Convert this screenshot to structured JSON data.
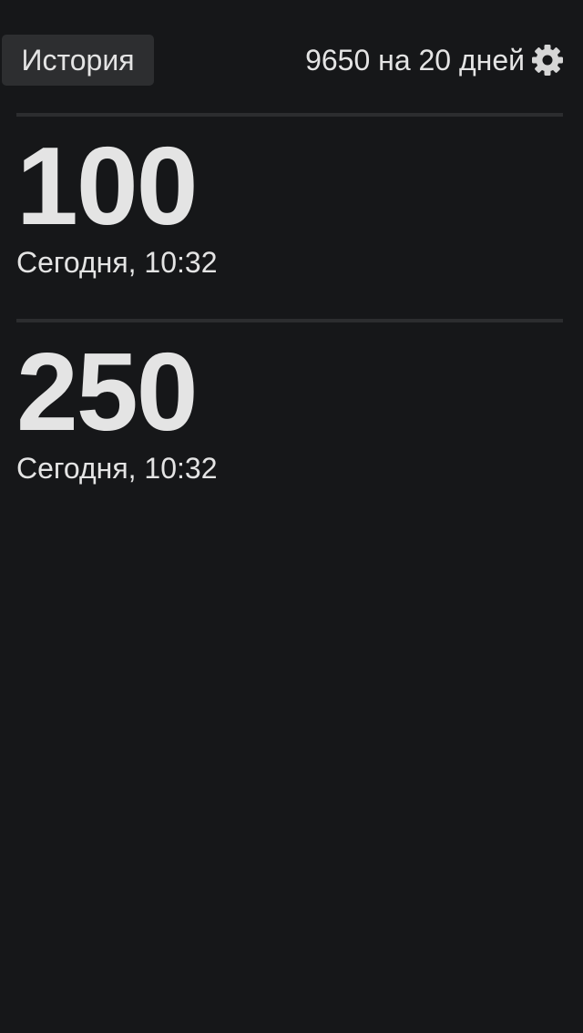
{
  "header": {
    "history_label": "История",
    "balance_text": "9650 на 20 дней",
    "settings_icon": "gear-icon"
  },
  "entries": [
    {
      "amount": "100",
      "date": "Сегодня, 10:32"
    },
    {
      "amount": "250",
      "date": "Сегодня, 10:32"
    }
  ],
  "colors": {
    "background": "#161719",
    "text": "#e4e4e4",
    "button_background": "#2d2e30",
    "divider": "#2c2d2f",
    "icon": "#d6d6d6"
  }
}
